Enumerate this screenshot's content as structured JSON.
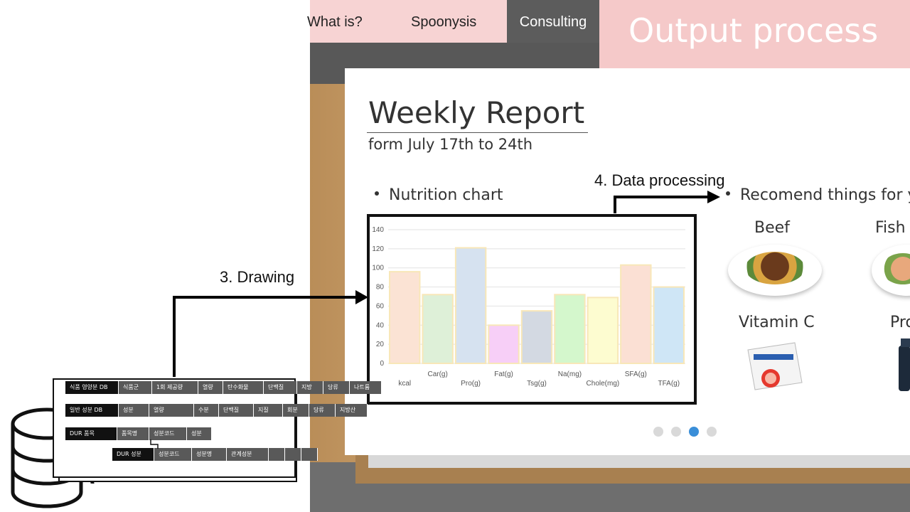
{
  "nav": {
    "items": [
      "What is?",
      "Spoonysis",
      "Consulting"
    ],
    "active": "Consulting"
  },
  "header": {
    "title": "Output process"
  },
  "report": {
    "title": "Weekly Report",
    "subtitle": "form July 17th  to 24th",
    "nutrition_heading": "Nutrition chart",
    "recommend_heading": "Recomend things for yo"
  },
  "recommendations": [
    {
      "label": "Beef"
    },
    {
      "label": "Fish s"
    },
    {
      "label": "Vitamin C"
    },
    {
      "label": "Pro"
    }
  ],
  "annotations": {
    "drawing": "3. Drawing",
    "data_processing": "4. Data  processing"
  },
  "pager": {
    "count": 4,
    "active_index": 2
  },
  "db_tables": {
    "row1": [
      "식품 영양분 DB",
      "식품군",
      "1회 제공량",
      "열량",
      "탄수화물",
      "단백질",
      "지방",
      "당류",
      "나트륨"
    ],
    "row2": [
      "일반 성분 DB",
      "성분",
      "열량",
      "수분",
      "단백질",
      "지질",
      "회분",
      "당류",
      "지방산"
    ],
    "row3": [
      "DUR 품목",
      "품목명",
      "성분코드",
      "성분"
    ],
    "row4": [
      "DUR 성분",
      "성분코드",
      "성분명",
      "관계성분",
      "",
      "",
      ""
    ]
  },
  "chart_data": {
    "type": "bar",
    "categories": [
      "kcal",
      "Car(g)",
      "Pro(g)",
      "Fat(g)",
      "Tsg(g)",
      "Na(mg)",
      "Chole(mg)",
      "SFA(g)",
      "TFA(g)"
    ],
    "values": [
      96,
      72,
      121,
      40,
      55,
      72,
      69,
      103,
      80
    ],
    "colors": [
      "#fbe3d4",
      "#def0d8",
      "#d6e2f0",
      "#f7cff7",
      "#d3d9e2",
      "#d4f7cc",
      "#fdfcd0",
      "#fbe0d4",
      "#cfe6f6"
    ],
    "yticks": [
      0,
      20,
      40,
      60,
      80,
      100,
      120,
      140
    ],
    "ylim": [
      0,
      140
    ],
    "grid": true
  }
}
